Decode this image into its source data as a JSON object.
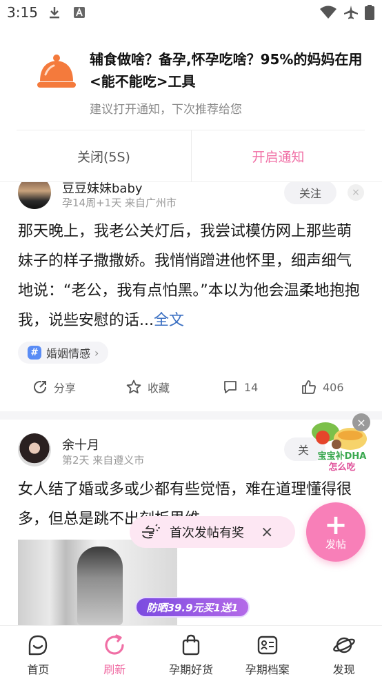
{
  "status_bar": {
    "time": "3:15"
  },
  "notification": {
    "title": "辅食做啥？备孕,怀孕吃啥？95%的妈妈在用<能不能吃>工具",
    "subtitle": "建议打开通知，下次推荐给您",
    "close_label": "关闭(5S)",
    "open_label": "开启通知"
  },
  "posts": [
    {
      "username": "豆豆妹妹baby",
      "meta": "孕14周+1天 来自广州市",
      "follow_label": "关注",
      "dismiss": "×",
      "body": "那天晚上，我老公关灯后，我尝试模仿网上那些萌妹子的样子撒撒娇。我悄悄蹭进他怀里，细声细气地说：“老公，我有点怕黑。”本以为他会温柔地抱抱我，说些安慰的话...",
      "more_label": "全文",
      "tag": "婚姻情感",
      "share_label": "分享",
      "fav_label": "收藏",
      "comments": "14",
      "likes": "406"
    },
    {
      "username": "余十月",
      "meta": "第2天 来自遵义市",
      "follow_label": "关",
      "body": "女人结了婚或多或少都有些觉悟，难在道理懂得很多，但总是跳不出刻板思维"
    }
  ],
  "floating": {
    "ad_line1": "宝宝补DHA",
    "ad_line2": "怎么吃",
    "tip_text": "首次发帖有奖",
    "tip_close": "×",
    "fab_plus": "+",
    "fab_label": "发帖",
    "promo_text": "防晒39.9元买1送1"
  },
  "tabs": [
    {
      "label": "首页",
      "active": false
    },
    {
      "label": "刷新",
      "active": true
    },
    {
      "label": "孕期好货",
      "active": false
    },
    {
      "label": "孕期档案",
      "active": false
    },
    {
      "label": "发现",
      "active": false
    }
  ],
  "colors": {
    "accent": "#f06fa5",
    "link": "#3a6fc2",
    "fab": "#f87fb8"
  }
}
